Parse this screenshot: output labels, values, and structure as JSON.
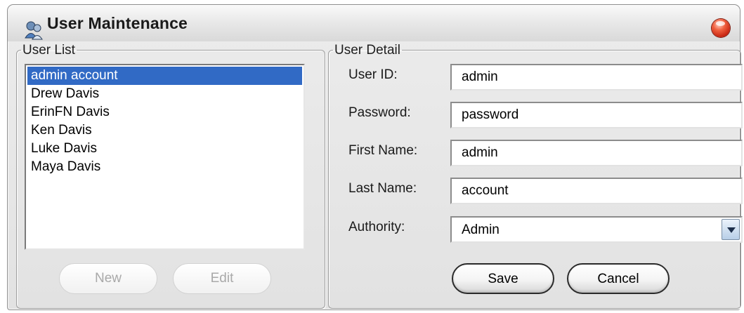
{
  "window": {
    "title": "User Maintenance"
  },
  "user_list": {
    "legend": "User List",
    "items": [
      "admin account",
      "Drew Davis",
      "ErinFN Davis",
      "Ken Davis",
      "Luke Davis",
      "Maya Davis"
    ],
    "selected_index": 0,
    "new_label": "New",
    "edit_label": "Edit"
  },
  "user_detail": {
    "legend": "User Detail",
    "user_id_label": "User ID:",
    "user_id_value": "admin",
    "password_label": "Password:",
    "password_value": "password",
    "first_name_label": "First Name:",
    "first_name_value": "admin",
    "last_name_label": "Last Name:",
    "last_name_value": "account",
    "authority_label": "Authority:",
    "authority_value": "Admin",
    "save_label": "Save",
    "cancel_label": "Cancel"
  },
  "icons": {
    "app": "users-icon",
    "close": "close-icon",
    "dropdown": "chevron-down-icon"
  },
  "colors": {
    "selection": "#316ac5",
    "close_button": "#d32d14"
  }
}
